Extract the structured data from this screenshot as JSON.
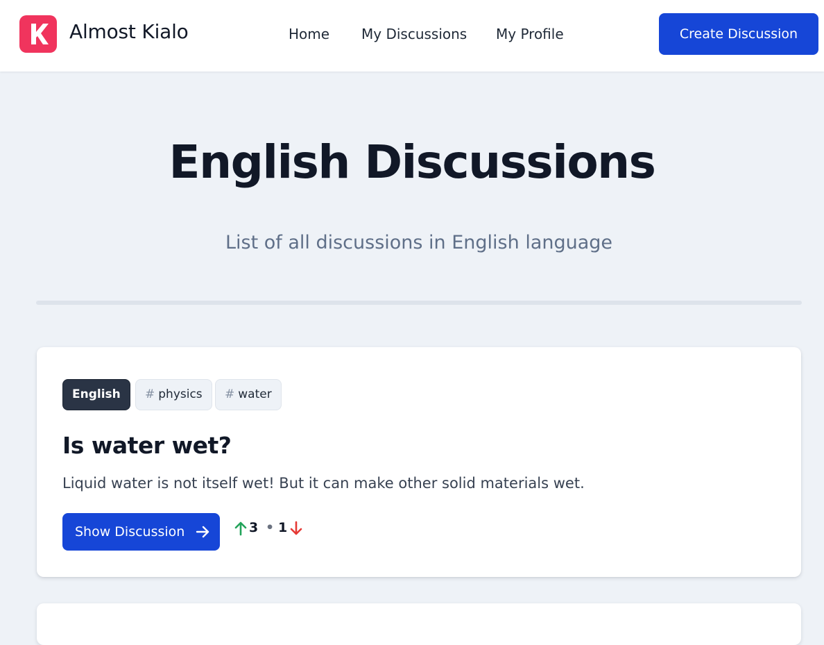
{
  "header": {
    "brand": "Almost Kialo",
    "logo_letter": "K",
    "nav": {
      "home": "Home",
      "my_discussions": "My Discussions",
      "my_profile": "My Profile"
    },
    "create_button": "Create Discussion"
  },
  "hero": {
    "title": "English Discussions",
    "subtitle": "List of all discussions in English language"
  },
  "discussions": [
    {
      "language": "English",
      "tags": [
        {
          "hash": "#",
          "label": "physics"
        },
        {
          "hash": "#",
          "label": "water"
        }
      ],
      "title": "Is water wet?",
      "description": "Liquid water is not itself wet! But it can make other solid materials wet.",
      "show_button": "Show Discussion",
      "upvotes": "3",
      "separator": "•",
      "downvotes": "1"
    }
  ],
  "colors": {
    "accent": "#1646d7",
    "logo": "#f0345d",
    "upvote": "#22a35a",
    "downvote": "#e53935",
    "background": "#eef2f7"
  },
  "icons": {
    "logo": "letter-k-logo-icon",
    "show_button_icon": "arrow-right-icon",
    "upvote": "arrow-up-icon",
    "downvote": "arrow-down-icon"
  }
}
